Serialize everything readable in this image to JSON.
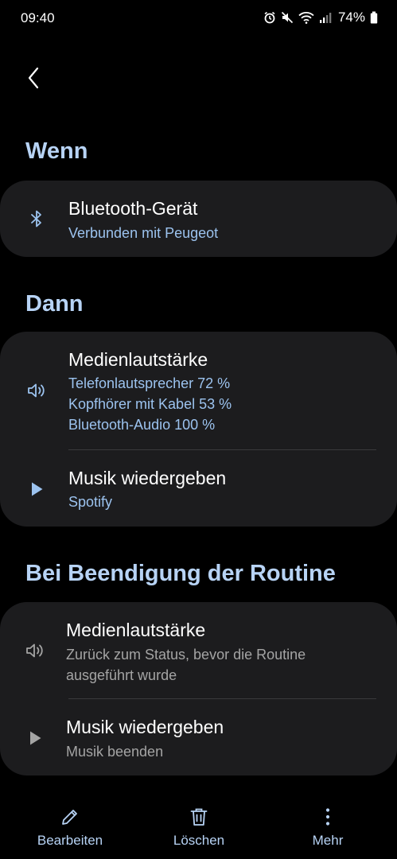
{
  "status_bar": {
    "time": "09:40",
    "battery": "74%",
    "icons": [
      "alarm-icon",
      "mute-icon",
      "wifi-icon",
      "signal-icon",
      "battery-icon"
    ]
  },
  "colors": {
    "background": "#000000",
    "card": "#1c1c1e",
    "accent_title": "#b7d3f5",
    "accent_subtitle": "#9cc3ef",
    "muted_subtitle": "#a4a4a4"
  },
  "sections": {
    "wenn": {
      "title": "Wenn",
      "items": [
        {
          "icon": "bluetooth-icon",
          "title": "Bluetooth-Gerät",
          "subtitle": "Verbunden mit Peugeot"
        }
      ]
    },
    "dann": {
      "title": "Dann",
      "items": [
        {
          "icon": "volume-icon",
          "title": "Medienlautstärke",
          "subtitle_lines": [
            "Telefonlautsprecher 72 %",
            "Kopfhörer mit Kabel 53 %",
            "Bluetooth-Audio 100 %"
          ]
        },
        {
          "icon": "play-icon",
          "title": "Musik wiedergeben",
          "subtitle": "Spotify"
        }
      ]
    },
    "ende": {
      "title": "Bei Beendigung der Routine",
      "items": [
        {
          "icon": "volume-icon",
          "title": "Medienlautstärke",
          "subtitle_lines": [
            "Zurück zum Status, bevor die Routine",
            "ausgeführt wurde"
          ]
        },
        {
          "icon": "play-icon",
          "title": "Musik wiedergeben",
          "subtitle": "Musik beenden"
        }
      ]
    }
  },
  "bottom_bar": {
    "edit": "Bearbeiten",
    "delete": "Löschen",
    "more": "Mehr"
  }
}
